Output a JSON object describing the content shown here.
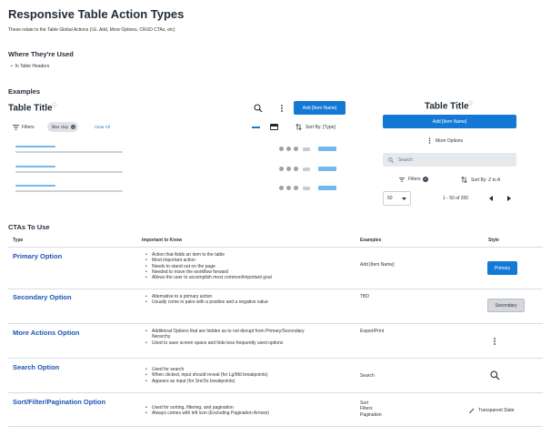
{
  "header": {
    "title": "Responsive Table Action Types",
    "subtitle": "These relate to the Table Global Actions (I.E. Add, More Options, CRUD CTAs, etc)"
  },
  "where_used": {
    "heading": "Where They're Used",
    "items": [
      "In Table Headers"
    ]
  },
  "examples": {
    "heading": "Examples",
    "left": {
      "title": "Table Title",
      "info_glyph": "ⓘ",
      "add_button": "Add [Item Name]",
      "filters_label": "Filters",
      "chip_label": "filter chip",
      "clear_all": "Clear All",
      "sort_label": "Sort By: [Type]"
    },
    "right": {
      "title": "Table Title",
      "info_glyph": "ⓘ",
      "add_button": "Add [Item Name]",
      "more_options": "More Options",
      "search_placeholder": "Search",
      "filters_label": "Filters",
      "filters_count": "4",
      "sort_label": "Sort By: Z to A",
      "page_size": "50",
      "pagination": "1 - 50 of 200"
    }
  },
  "ctas": {
    "heading": "CTAs To Use",
    "columns": [
      "Type",
      "Important to Know",
      "Examples",
      "Style"
    ],
    "rows": [
      {
        "type": "Primary Option",
        "notes": [
          "Action that Adds an item to the table",
          "Most important action",
          "Needs to stand out on the page",
          "Needed to move the workflow forward",
          "Allows the user to accomplish most common/important goal"
        ],
        "examples": [
          "Add [Item Name]"
        ],
        "style_label": "Primary"
      },
      {
        "type": "Secondary Option",
        "notes": [
          "Alternative to a primary action",
          "Usually come in pairs with a positive and a negative value"
        ],
        "examples": [
          "TBD"
        ],
        "style_label": "Secondary"
      },
      {
        "type": "More Actions Option",
        "notes": [
          "Additional Options that are hidden as to not disrupt from Primary/Secondary",
          "Nerarchy",
          "Used to save screen space and hide less frequently used options"
        ],
        "examples": [
          "Export/Print"
        ],
        "style_label": ""
      },
      {
        "type": "Search Option",
        "notes": [
          "Used for search",
          "When clicked, input should reveal (for Lg/Md breakpoints)",
          "Appears as input (for Sm/Xs breakpoints)"
        ],
        "examples": [
          "Search"
        ],
        "style_label": ""
      },
      {
        "type": "Sort/Filter/Pagination Option",
        "notes": [
          "Used for sorting, filtering, and pagination",
          "Always comes with left icon (Excluding Pagination Arrows)"
        ],
        "examples": [
          "Sort",
          "Filters",
          "Pagination"
        ],
        "style_label": "Transparent Slate"
      }
    ]
  },
  "colors": {
    "primary": "#1479d4",
    "link": "#1c55b5",
    "text": "#1f2a37",
    "bar_blue": "#75b8ec",
    "bar_gray": "#cdd2d8"
  }
}
